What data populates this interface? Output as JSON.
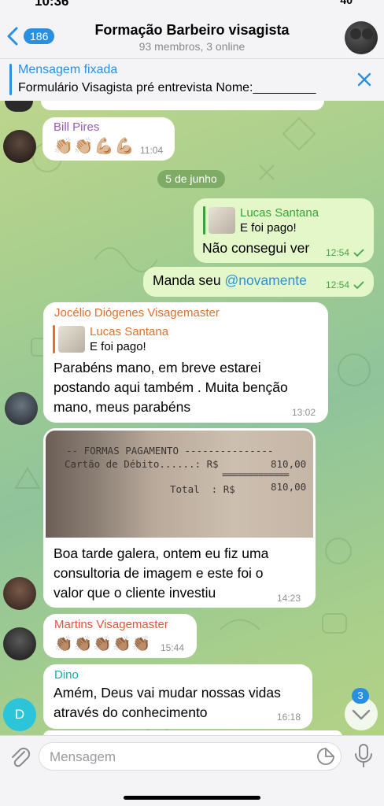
{
  "header": {
    "back_count": "186",
    "title": "Formação Barbeiro visagista",
    "subtitle": "93 membros, 3 online"
  },
  "pinned": {
    "title": "Mensagem fixada",
    "text": "Formulário Visagista pré entrevista    Nome:_________"
  },
  "date_separator": "5 de junho",
  "messages": {
    "m1": {
      "sender": "Bill Pires",
      "emoji": "👏🏼👏🏼💪🏼💪🏼",
      "time": "11:04"
    },
    "m2": {
      "reply_name": "Lucas Santana",
      "reply_text": "E foi pago!",
      "text": "Não consegui ver",
      "time": "12:54"
    },
    "m3": {
      "text_prefix": "Manda seu ",
      "mention": "@novamente",
      "time": "12:54"
    },
    "m4": {
      "sender": "Jocélio Diógenes Visagemaster",
      "reply_name": "Lucas Santana",
      "reply_text": "E foi pago!",
      "lines": [
        "Parabéns mano, em breve estarei",
        "postando aqui também .  Muita benção",
        "mano, meus parabéns"
      ],
      "time": "13:02"
    },
    "m5": {
      "receipt": {
        "line1": "-- FORMAS PAGAMENTO ---------------",
        "line2_label": "Cartão de Débito......: R$",
        "line2_value": "810,00",
        "line3_label": "Total  : R$",
        "line3_value": "810,00"
      },
      "lines": [
        "Boa tarde galera, ontem eu fiz uma",
        "consultoria de imagem e este foi o",
        "valor que o cliente investiu"
      ],
      "time": "14:23"
    },
    "m6": {
      "sender": "Martins Visagemaster",
      "emoji": "👏🏽👏🏽👏🏽👏🏽👏🏽",
      "time": "15:44"
    },
    "m7": {
      "sender": "Dino",
      "lines": [
        "Amém, Deus vai mudar nossas vidas",
        "através do conhecimento"
      ],
      "time": "16:18"
    }
  },
  "avatars": {
    "dino_initial": "D"
  },
  "scroll": {
    "unread": "3"
  },
  "composer": {
    "placeholder": "Mensagem"
  },
  "colors": {
    "accent": "#2a8fe0",
    "outgoing_bubble": "#e3f7c9",
    "sender_bill": "#9b59b6",
    "sender_jocelio": "#e0702a",
    "sender_martins": "#e0553c",
    "sender_dino": "#21a6a6",
    "reply_green": "#3aa13a",
    "reply_orange": "#e0702a"
  }
}
